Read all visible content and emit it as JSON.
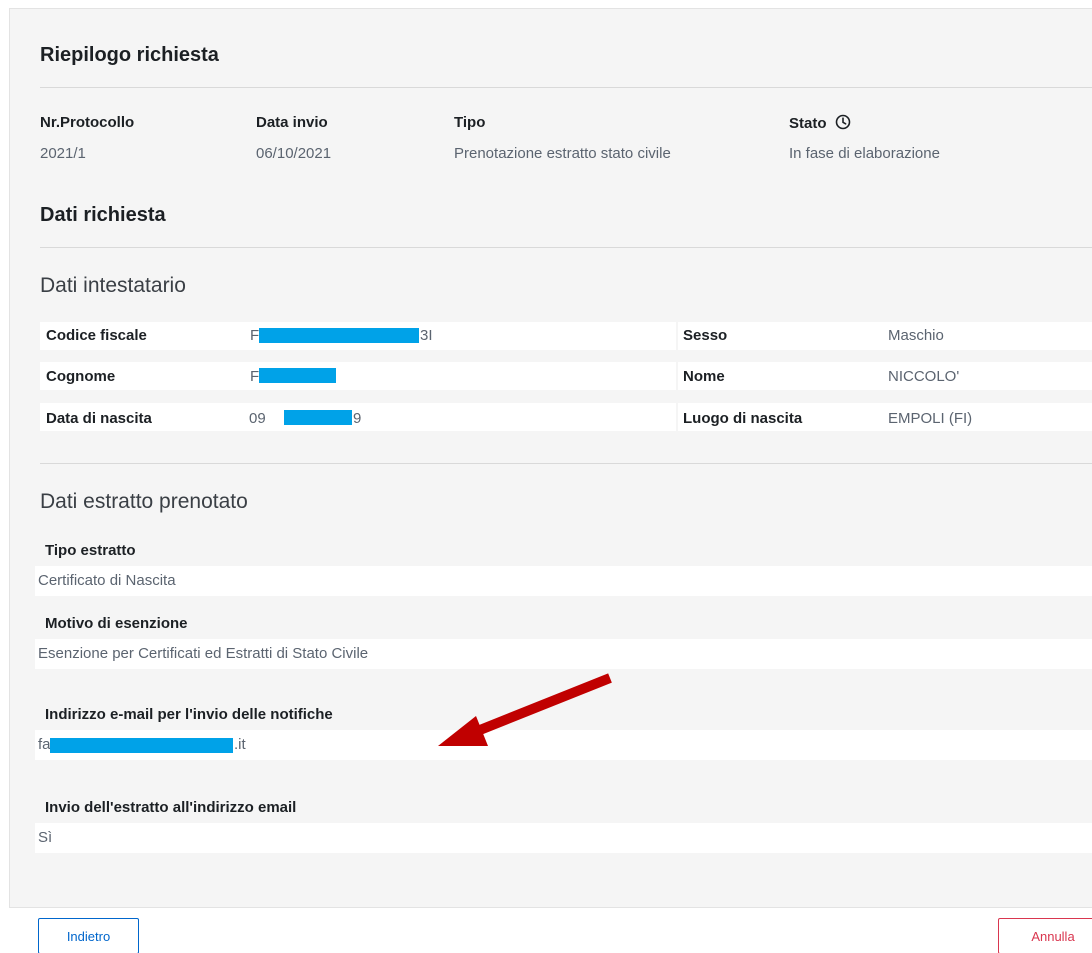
{
  "summary": {
    "title": "Riepilogo richiesta",
    "protocol_label": "Nr.Protocollo",
    "protocol_value": "2021/1",
    "date_label": "Data invio",
    "date_value": "06/10/2021",
    "type_label": "Tipo",
    "type_value": "Prenotazione estratto stato civile",
    "status_label": "Stato",
    "status_value": "In fase di elaborazione"
  },
  "request": {
    "title": "Dati richiesta",
    "holder": {
      "title": "Dati intestatario",
      "codice_fiscale_label": "Codice fiscale",
      "codice_fiscale_prefix": "F",
      "codice_fiscale_suffix": "3I",
      "sesso_label": "Sesso",
      "sesso_value": "Maschio",
      "cognome_label": "Cognome",
      "cognome_prefix": "F",
      "nome_label": "Nome",
      "nome_value": "NICCOLO'",
      "data_nascita_label": "Data di nascita",
      "data_nascita_prefix": "09",
      "data_nascita_suffix": "9",
      "luogo_nascita_label": "Luogo di nascita",
      "luogo_nascita_value": "EMPOLI (FI)"
    },
    "extract": {
      "title": "Dati estratto prenotato",
      "tipo_label": "Tipo estratto",
      "tipo_value": "Certificato di Nascita",
      "motivo_label": "Motivo di esenzione",
      "motivo_value": "Esenzione per Certificati ed Estratti di Stato Civile",
      "email_label": "Indirizzo e-mail per l'invio delle notifiche",
      "email_prefix": "fa",
      "email_suffix": ".it",
      "invio_label": "Invio dell'estratto all'indirizzo email",
      "invio_value": "Sì"
    }
  },
  "buttons": {
    "back": "Indietro",
    "cancel": "Annulla"
  },
  "colors": {
    "redaction": "#00a2e8",
    "arrow": "#c00000",
    "primary": "#0066cc",
    "danger": "#d9364f"
  }
}
